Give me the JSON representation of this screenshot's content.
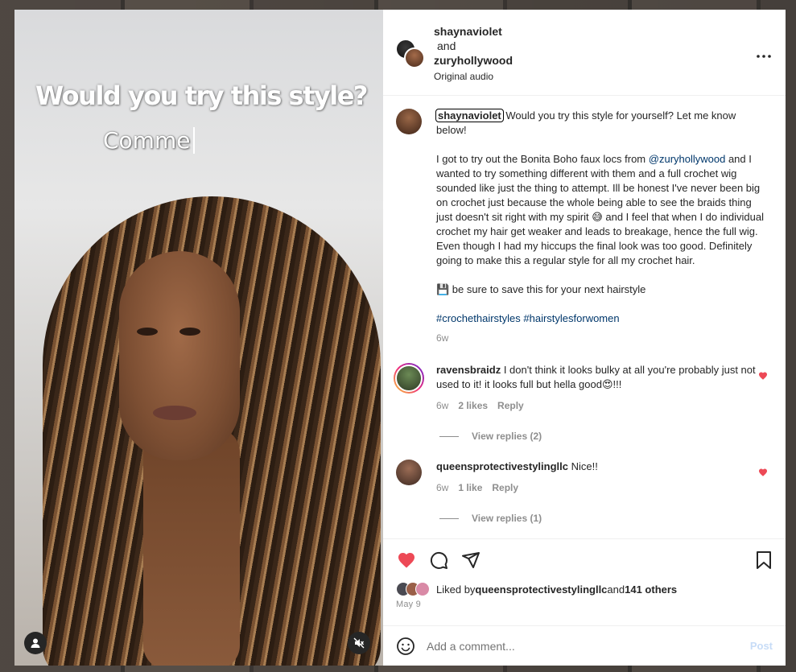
{
  "video": {
    "overlay_title": "Would you try this style?",
    "overlay_sub": "Comme"
  },
  "header": {
    "user1": "shaynaviolet",
    "joiner": "and",
    "user2": "zuryhollywood",
    "audio": "Original audio"
  },
  "caption": {
    "username": "shaynaviolet",
    "line1": "Would you try this style for yourself? Let me know below!",
    "para2_before": "I got to try out the Bonita Boho faux locs from ",
    "para2_mention": "@zuryhollywood",
    "para2_after": " and I wanted to try something different with them and a full crochet wig sounded like just the thing to attempt. Ill be honest I've never been big on crochet just because the whole being able to see the braids thing just doesn't sit right with my spirit 😅 and I feel that when I do individual crochet my hair get weaker and leads to breakage, hence the full wig. Even though I had my hiccups the final look was too good. Definitely going to make this a regular style for all my crochet hair.",
    "save_line": "💾 be sure to save this for your next hairstyle",
    "hashtags": "#crochethairstyles #hairstylesforwomen",
    "time": "6w"
  },
  "comments": [
    {
      "username": "ravensbraidz",
      "text": "I don't think it looks bulky at all you're probably just not used to it! it looks full but hella good😍!!!",
      "time": "6w",
      "likes": "2 likes",
      "reply": "Reply",
      "view_replies": "View replies (2)"
    },
    {
      "username": "queensprotectivestylingllc",
      "text": "Nice!!",
      "time": "6w",
      "likes": "1 like",
      "reply": "Reply",
      "view_replies": "View replies (1)"
    }
  ],
  "likes": {
    "prefix": "Liked by ",
    "user": "queensprotectivestylingllc",
    "middle": " and ",
    "others": "141 others"
  },
  "date": "May 9",
  "add_comment": {
    "placeholder": "Add a comment...",
    "post_label": "Post"
  },
  "colors": {
    "like_red": "#ed4956",
    "link_blue": "#00376b",
    "muted": "#8e8e8e"
  }
}
